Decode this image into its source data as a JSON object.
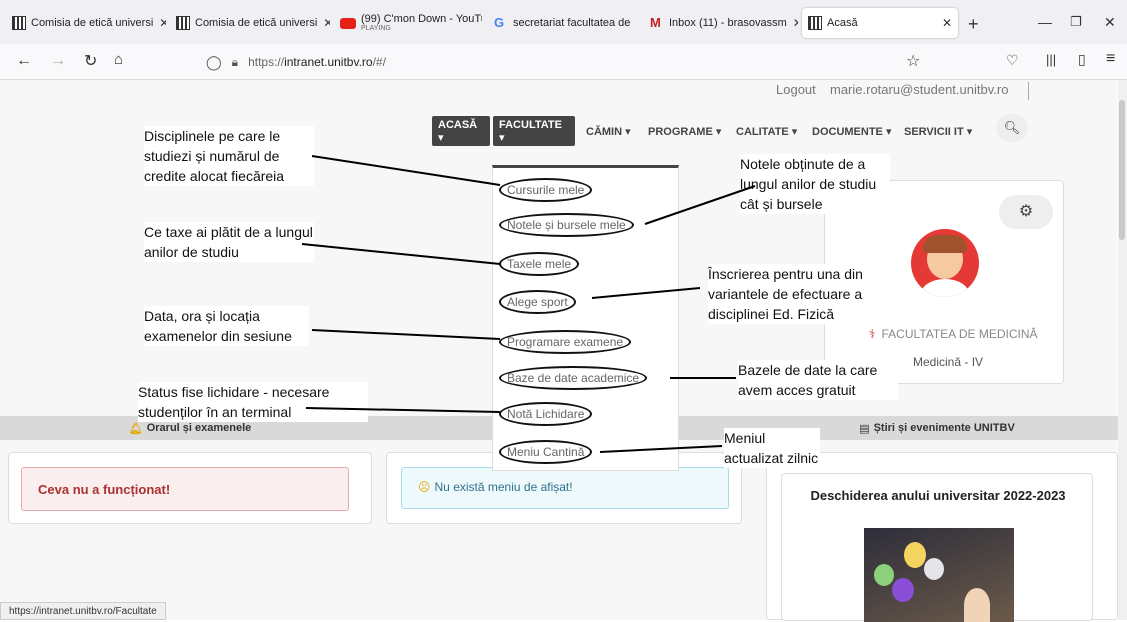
{
  "browser": {
    "tabs": [
      {
        "label": "Comisia de etică universi",
        "sub": ""
      },
      {
        "label": "Comisia de etică universi",
        "sub": ""
      },
      {
        "label": "(99) C'mon Down - YouTu",
        "sub": "PLAYING"
      },
      {
        "label": "secretariat facultatea de",
        "sub": ""
      },
      {
        "label": "Inbox (11) - brasovassm",
        "sub": ""
      },
      {
        "label": "Acasă",
        "sub": ""
      }
    ],
    "url_prefix": "https://",
    "url_host": "intranet.unitbv.ro",
    "url_path": "/#/",
    "status_url": "https://intranet.unitbv.ro/Facultate"
  },
  "topbar": {
    "logout": "Logout",
    "email": "marie.rotaru@student.unitbv.ro"
  },
  "menu": [
    "ACASĂ ▾",
    "FACULTATE ▾",
    "CĂMIN ▾",
    "PROGRAME ▾",
    "CALITATE ▾",
    "DOCUMENTE ▾",
    "SERVICII IT ▾"
  ],
  "dropdown": [
    "Cursurile mele",
    "Notele și bursele mele",
    "Taxele mele",
    "Alege sport",
    "Programare examene",
    "Baze de date academice",
    "Notă Lichidare",
    "Meniu Cantină"
  ],
  "annotations": {
    "a1": "Disciplinele pe care le studiezi și numărul de credite alocat fiecăreia",
    "a2": "Ce taxe ai plătit de a lungul anilor de studiu",
    "a3": "Data, ora și locația examenelor din sesiune",
    "a4": "Status fise lichidare - necesare studenților în an terminal",
    "a5": "Notele obținute de a lungul anilor de studiu cât și bursele",
    "a6": "Înscrierea pentru una din variantele de efectuare a disciplinei Ed. Fizică",
    "a7": "Bazele de date la care avem acces gratuit",
    "a8": "Meniul actualizat zilnic"
  },
  "profile": {
    "faculty": "FACULTATEA DE MEDICINĂ",
    "program": "Medicină - IV"
  },
  "sections": {
    "orar": "Orarul și examenele",
    "stiri": "Știri și evenimente UNITBV"
  },
  "cards": {
    "error": "Ceva nu a funcționat!",
    "menu_empty": "Nu există meniu de afișat!",
    "news_title": "Deschiderea anului universitar 2022-2023"
  },
  "colors": {
    "accent": "#c0392b",
    "dark_menu": "#444444"
  }
}
